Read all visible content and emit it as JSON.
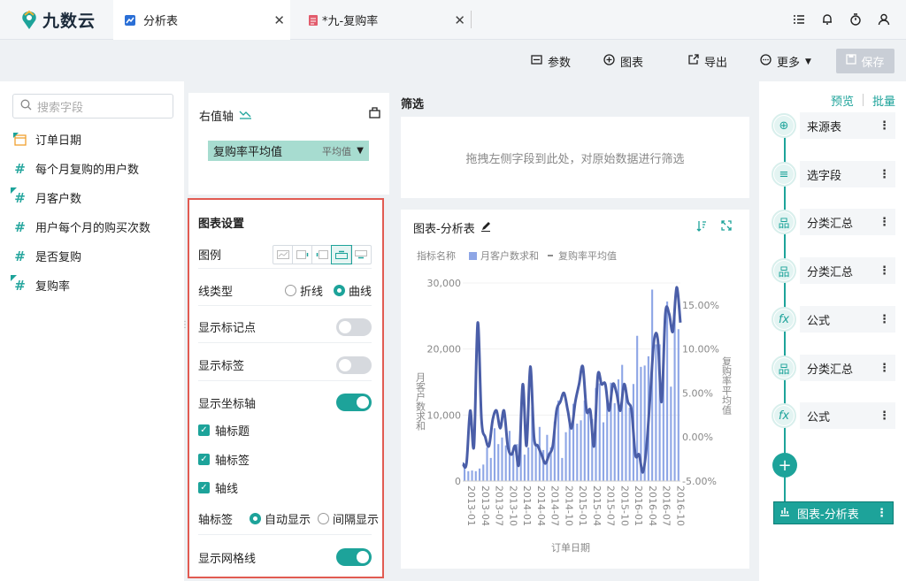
{
  "app": {
    "logo_text": "九数云"
  },
  "tabs": [
    {
      "label": "分析表",
      "icon": "chart-icon"
    },
    {
      "label": "*九-复购率",
      "icon": "sheet-icon"
    }
  ],
  "toolbar": {
    "params": "参数",
    "chart": "图表",
    "export": "导出",
    "more": "更多",
    "save": "保存"
  },
  "fields": {
    "search_placeholder": "搜索字段",
    "items": [
      "订单日期",
      "每个月复购的用户数",
      "月客户数",
      "用户每个月的购买次数",
      "是否复购",
      "复购率"
    ]
  },
  "yaxis": {
    "title": "右值轴",
    "measure": "复购率平均值",
    "agg": "平均值"
  },
  "settings": {
    "title": "图表设置",
    "legend": "图例",
    "line_type": "线类型",
    "line_opt1": "折线",
    "line_opt2": "曲线",
    "show_markers": "显示标记点",
    "show_labels": "显示标签",
    "show_axis": "显示坐标轴",
    "axis_title": "轴标题",
    "axis_labels": "轴标签",
    "axis_line": "轴线",
    "axis_label_mode": "轴标签",
    "auto_display": "自动显示",
    "interval_display": "间隔显示",
    "show_grid": "显示网格线",
    "toggles": {
      "markers": false,
      "labels": false,
      "axis": true,
      "grid": true
    }
  },
  "filter": {
    "title": "筛选",
    "placeholder": "拖拽左侧字段到此处，对原始数据进行筛选"
  },
  "chart": {
    "title": "图表-分析表",
    "legend_label": "指标名称",
    "series1": "月客户数求和",
    "series2": "复购率平均值",
    "ylabel_left": "月客户数求和",
    "ylabel_right": "复购率平均值",
    "xlabel": "订单日期",
    "bar_color": "#8ea6e6",
    "line_color": "#4a5ea8"
  },
  "chart_data": {
    "type": "bar+line",
    "x_ticks": [
      "2013-01",
      "2013-04",
      "2013-07",
      "2013-10",
      "2014-01",
      "2014-04",
      "2014-07",
      "2014-10",
      "2015-01",
      "2015-04",
      "2015-07",
      "2015-10",
      "2016-01",
      "2016-04",
      "2016-07",
      "2016-10"
    ],
    "y_left_ticks": [
      "0",
      "10,000",
      "20,000",
      "30,000"
    ],
    "y_right_ticks": [
      "-5.00%",
      "0.00%",
      "5.00%",
      "10.00%",
      "15.00%"
    ],
    "ylim_left": [
      0,
      30000
    ],
    "ylim_right": [
      -5,
      17.5
    ],
    "bars": [
      2700,
      1500,
      1600,
      1500,
      1900,
      2500,
      5100,
      3500,
      8000,
      5600,
      6600,
      5400,
      7600,
      4200,
      5600,
      8800,
      4000,
      5100,
      11200,
      5700,
      8200,
      4700,
      7000,
      5100,
      9000,
      12200,
      3500,
      7400,
      8700,
      11700,
      8700,
      9200,
      12200,
      10600,
      9400,
      14100,
      14800,
      8900,
      12500,
      14900,
      11800,
      15400,
      17600,
      14200,
      11100,
      14700,
      22000,
      17300,
      17500,
      18900,
      29000,
      20700,
      20700,
      17700,
      27200,
      14300,
      27100,
      23000
    ],
    "line": [
      -3,
      -3,
      3,
      -1,
      13,
      2,
      0,
      -1,
      2,
      3,
      1,
      3,
      -1,
      -2,
      -1,
      -3,
      6,
      -1,
      8,
      0,
      -1,
      -2,
      -3,
      -2,
      -1,
      3,
      4,
      5,
      3,
      1,
      4,
      6,
      8,
      3,
      3,
      -1,
      7,
      6,
      6,
      3,
      6,
      5,
      3,
      6,
      4,
      3,
      -2,
      -2,
      -4,
      -1,
      5,
      11,
      11,
      4,
      14,
      14,
      12,
      17,
      13
    ]
  },
  "flow": {
    "preview": "预览",
    "batch": "批量",
    "steps": [
      "来源表",
      "选字段",
      "分类汇总",
      "分类汇总",
      "公式",
      "分类汇总",
      "公式"
    ],
    "last": "图表-分析表"
  }
}
